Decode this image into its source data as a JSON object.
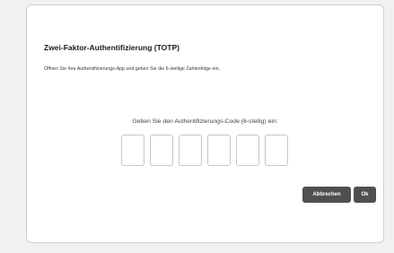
{
  "dialog": {
    "title": "Zwei-Faktor-Authentifizierung (TOTP)",
    "description": "Öffnen Sie Ihre Authentifizierungs-App und geben Sie die 6-stellige Zahlenfolge ein.",
    "code_prompt": "Geben Sie den Authentifizierungs-Code (6-stellig) ein:",
    "code_digits": [
      "",
      "",
      "",
      "",
      "",
      ""
    ],
    "buttons": {
      "cancel_label": "Abbrechen",
      "ok_label": "Ok"
    }
  },
  "colors": {
    "background": "#f1f1f1",
    "dialog_background": "#ffffff",
    "button_background": "#50504f",
    "button_text": "#ffffff"
  }
}
